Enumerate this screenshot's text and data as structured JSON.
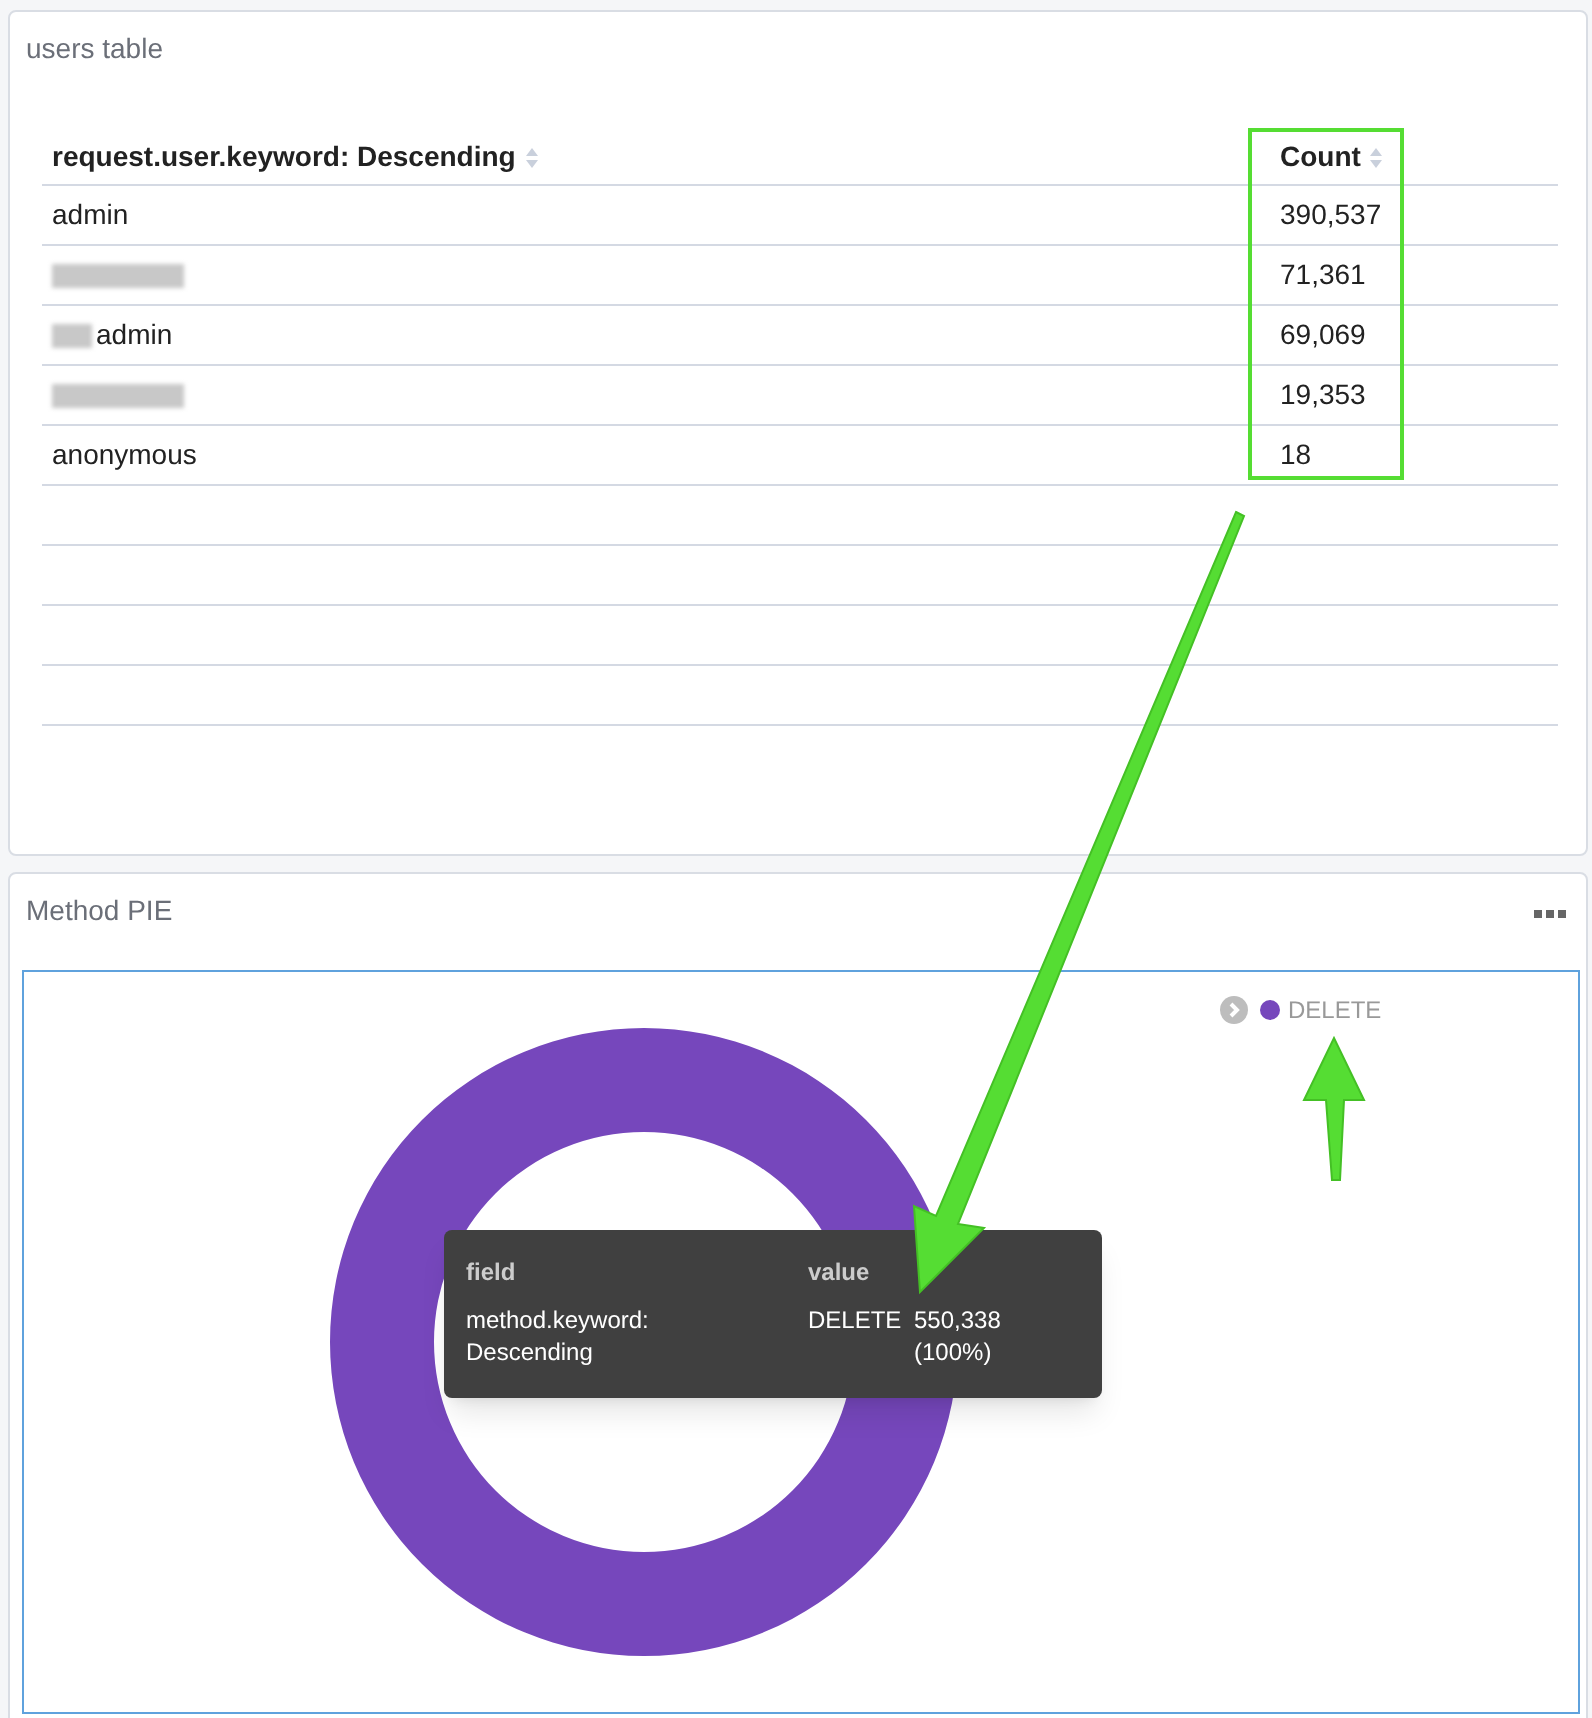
{
  "users_panel": {
    "title": "users table",
    "table": {
      "columns": [
        {
          "label": "request.user.keyword: Descending"
        },
        {
          "label": "Count"
        }
      ],
      "rows": [
        {
          "user": "admin",
          "redacted": false,
          "count": "390,537"
        },
        {
          "redacted": true,
          "count": "71,361"
        },
        {
          "user": "admin",
          "redacted": true,
          "count": "69,069"
        },
        {
          "redacted": true,
          "count": "19,353"
        },
        {
          "user": "anonymous",
          "redacted": false,
          "count": "18"
        }
      ]
    }
  },
  "pie_panel": {
    "title": "Method PIE",
    "legend": [
      {
        "label": "DELETE",
        "color": "#7647bc"
      }
    ],
    "tooltip": {
      "headers": [
        "field",
        "value"
      ],
      "field": "method.keyword: Descending",
      "value": "DELETE",
      "count": "550,338",
      "percent": "(100%)"
    }
  }
}
